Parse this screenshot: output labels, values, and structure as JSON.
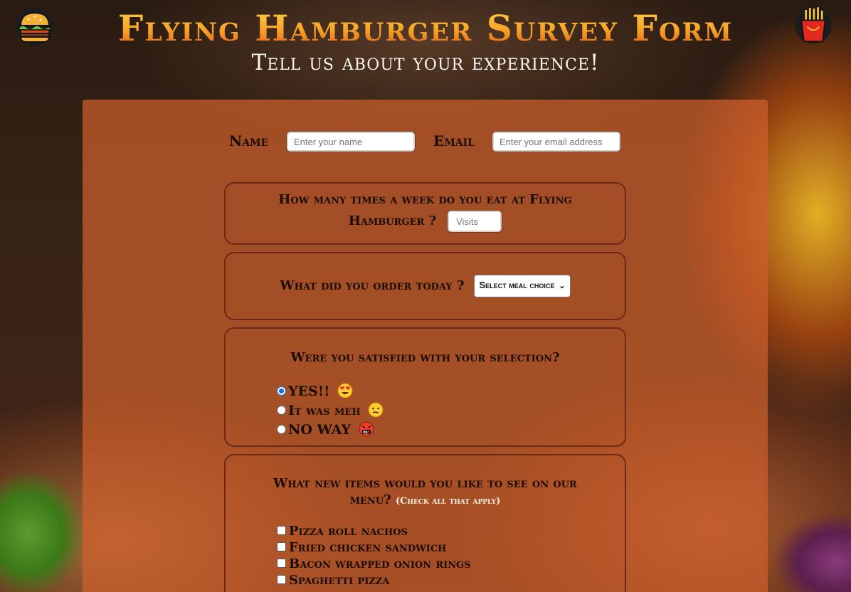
{
  "header": {
    "title": "Flying Hamburger Survey Form",
    "subtitle": "Tell us about your experience!"
  },
  "contact": {
    "name_label": "Name",
    "name_placeholder": "Enter your name",
    "email_label": "Email",
    "email_placeholder": "Enter your email address"
  },
  "visits": {
    "question_line1": "How many times a week do you eat at Flying",
    "question_line2": "Hamburger ?",
    "placeholder": "Visits"
  },
  "order": {
    "question": "What did you order today ?",
    "selected": "Select meal choice"
  },
  "satisfaction": {
    "question": "Were you satisfied with your selection?",
    "options": [
      {
        "label": "YES!!",
        "checked": true
      },
      {
        "label": "It was meh",
        "checked": false
      },
      {
        "label": "NO WAY",
        "checked": false
      }
    ]
  },
  "new_items": {
    "question_line1": "What new items would you like to see on our",
    "question_line2": "menu?",
    "note": "(Check all that apply)",
    "options": [
      {
        "label": "Pizza roll nachos",
        "checked": false
      },
      {
        "label": "Fried chicken sandwich",
        "checked": false
      },
      {
        "label": "Bacon wrapped onion rings",
        "checked": false
      },
      {
        "label": "Spaghetti pizza",
        "checked": false
      }
    ]
  },
  "icons": {
    "left_logo": "hamburger-icon",
    "right_logo": "french-fries-icon",
    "yes_emoji": "heart-eyes-emoji-icon",
    "meh_emoji": "confused-face-emoji-icon",
    "no_emoji": "angry-cursing-face-emoji-icon"
  },
  "colors": {
    "title_gradient_top": "#ffd34a",
    "title_gradient_bottom": "#d9561a",
    "panel": "#cd5f2d",
    "box_border": "#6b2a16",
    "radio_checked": "#1a6fe0"
  }
}
